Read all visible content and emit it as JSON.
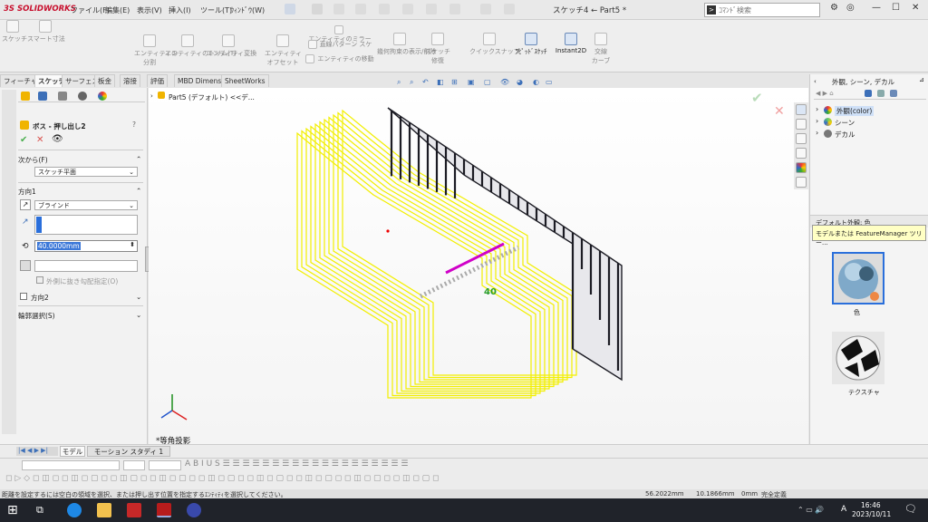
{
  "titlebar": {
    "logo": "3S SOLIDWORKS",
    "menus": [
      "ファイル(F)",
      "編集(E)",
      "表示(V)",
      "挿入(I)",
      "ツール(T)",
      "ｳｨﾝﾄﾞｳ(W)"
    ],
    "doc_title": "スケッチ4 ← Part5 *",
    "search_placeholder": "ｺﾏﾝﾄﾞ検索",
    "help": "?"
  },
  "ribbon": {
    "items": [
      {
        "label": "スケッチ",
        "active": false
      },
      {
        "label": "スマート寸法",
        "active": false
      },
      {
        "label": "エンティティの\n分割",
        "active": false
      },
      {
        "label": "エンティティのトリム(T)",
        "active": false
      },
      {
        "label": "エンティティ変換",
        "active": false
      },
      {
        "label": "エンティティ\nオフセット",
        "active": false
      },
      {
        "label": "エンティティのミラー",
        "active": false
      },
      {
        "label": "直線パターン スケ",
        "active": false
      },
      {
        "label": "エンティティの移動",
        "active": false
      },
      {
        "label": "幾何拘束の表示/削除",
        "active": false
      },
      {
        "label": "スケッチ\n修復",
        "active": false
      },
      {
        "label": "クイックスナップ",
        "active": false
      },
      {
        "label": "ﾗﾋﾟｯﾄﾞｽｹｯﾁ",
        "active": true
      },
      {
        "label": "Instant2D",
        "active": true
      },
      {
        "label": "交線\nカーブ",
        "active": false
      }
    ]
  },
  "cm_tabs": [
    {
      "label": "フィーチャー",
      "active": false
    },
    {
      "label": "スケッチ",
      "active": true
    },
    {
      "label": "サーフェス",
      "active": false
    },
    {
      "label": "板金",
      "active": false
    },
    {
      "label": "溶接",
      "active": false
    },
    {
      "label": "評価",
      "active": false
    },
    {
      "label": "MBD Dimension",
      "active": false
    },
    {
      "label": "SheetWorks",
      "active": false
    }
  ],
  "property_manager": {
    "title": "ボス - 押し出し2",
    "help": "?",
    "from_label": "次から(F)",
    "from_value": "スケッチ平面",
    "direction1_label": "方向1",
    "end_condition": "ブラインド",
    "depth_value": "40.0000mm",
    "draft_outward": "外側に抜き勾配指定(O)",
    "direction2_label": "方向2",
    "contour_label": "輪郭選択(S)"
  },
  "viewport": {
    "breadcrumb": "Part5 (デフォルト) <<デ...",
    "view_label": "*等角投影",
    "dim_text": "40"
  },
  "right_panel": {
    "title": "外観, シーン, デカル",
    "tree": [
      {
        "label": "外観(color)",
        "highlight": true
      },
      {
        "label": "シーン",
        "highlight": false
      },
      {
        "label": "デカル",
        "highlight": false
      }
    ],
    "default_appearance_label": "デフォルト外観: 色",
    "tooltip": "モデルまたは FeatureManager ツリー...",
    "thumb1_label": "色",
    "thumb2_label": "テクスチャ"
  },
  "bottom_tabs": [
    {
      "label": "モデル",
      "active": true
    },
    {
      "label": "モーション スタディ 1",
      "active": false
    }
  ],
  "status": {
    "message": "距離を設定するには空白の領域を選択、または押し出す位置を指定するｴﾝﾃｨﾃｨを選択してください。",
    "x": "56.2022mm",
    "y": "10.1866mm",
    "z": "0mm",
    "state": "完全定義"
  },
  "taskbar": {
    "time": "16:46",
    "date": "2023/10/11",
    "ime": "A"
  },
  "colors": {
    "yellow": "#f2ef00",
    "dark_bar": "#1c1c24",
    "accent": "#2a6fdb",
    "pink": "#d000c8",
    "ok_green": "#4caf50",
    "cancel_red": "#d9534f"
  }
}
